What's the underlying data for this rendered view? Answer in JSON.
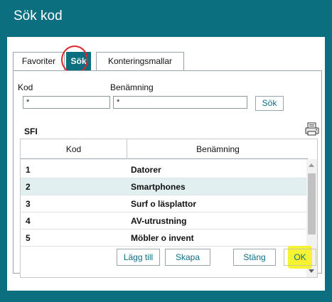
{
  "window": {
    "title": "Sök kod"
  },
  "tabs": [
    {
      "label": "Favoriter",
      "active": false
    },
    {
      "label": "Sök",
      "active": true
    },
    {
      "label": "Konteringsmallar",
      "active": false
    }
  ],
  "search": {
    "kod_label": "Kod",
    "ben_label": "Benämning",
    "kod_value": "*",
    "ben_value": "*",
    "button_label": "Sök"
  },
  "section": {
    "title": "SFI",
    "print_icon": "printer-icon"
  },
  "grid": {
    "columns": [
      "Kod",
      "Benämning"
    ],
    "rows": [
      {
        "kod": "1",
        "ben": "Datorer"
      },
      {
        "kod": "2",
        "ben": "Smartphones"
      },
      {
        "kod": "3",
        "ben": "Surf o läsplattor"
      },
      {
        "kod": "4",
        "ben": "AV-utrustning"
      },
      {
        "kod": "5",
        "ben": "Möbler o invent"
      }
    ]
  },
  "buttons": {
    "lagg_till": "Lägg till",
    "skapa": "Skapa",
    "stang": "Stäng",
    "ok": "OK"
  },
  "colors": {
    "accent": "#0b6f80",
    "row_highlight": "#e1eff1",
    "annotation_circle": "#e0242a",
    "annotation_highlight": "#f6f21c"
  }
}
